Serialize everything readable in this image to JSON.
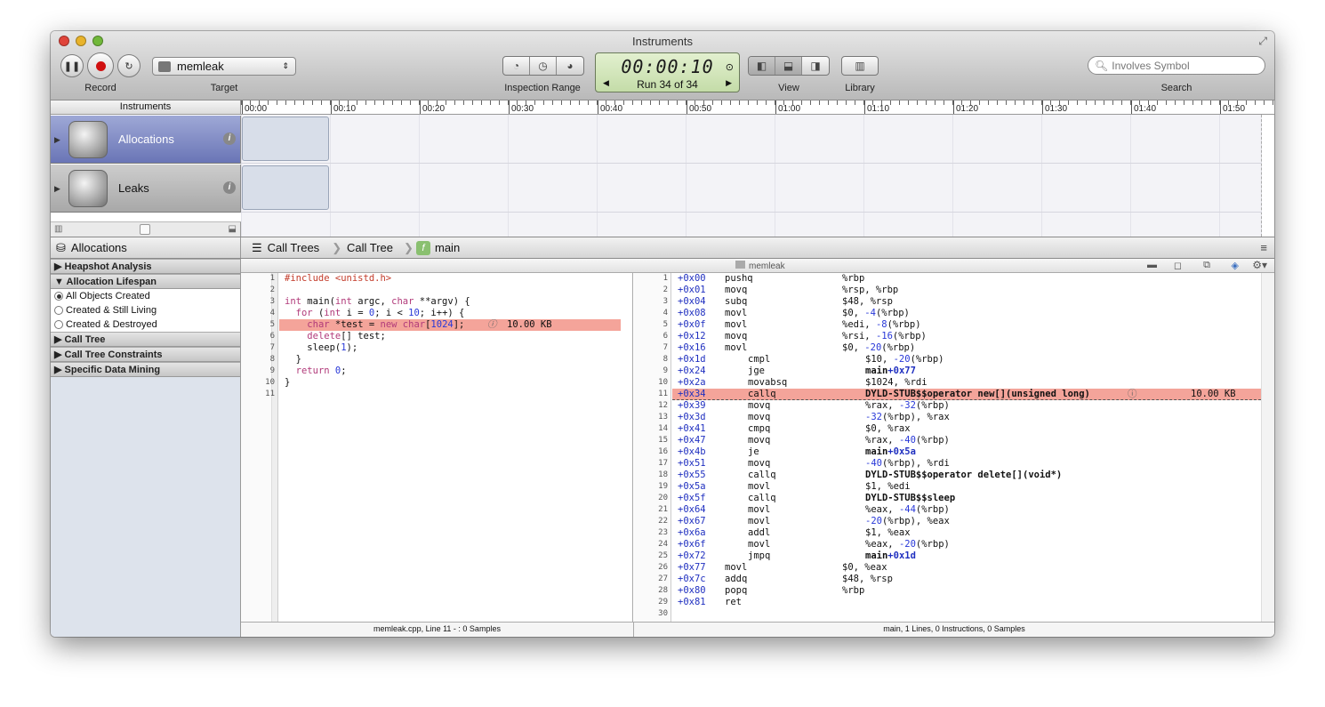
{
  "window": {
    "title": "Instruments"
  },
  "toolbar": {
    "record_label": "Record",
    "target_label": "Target",
    "target_value": "memleak",
    "inspection_label": "Inspection Range",
    "time": "00:00:10",
    "run": "Run 34 of 34",
    "view_label": "View",
    "library_label": "Library",
    "search_placeholder": "Involves Symbol",
    "search_label": "Search"
  },
  "instruments": {
    "header": "Instruments",
    "items": [
      {
        "name": "Allocations"
      },
      {
        "name": "Leaks"
      }
    ]
  },
  "ruler": [
    "00:00",
    "00:10",
    "00:20",
    "00:30",
    "00:40",
    "00:50",
    "01:00",
    "01:10",
    "01:20",
    "01:30",
    "01:40",
    "01:50"
  ],
  "nav": {
    "left": "Allocations",
    "crumbs": [
      "Call Trees",
      "Call Tree",
      "main"
    ]
  },
  "sidebar": {
    "heapshot": "Heapshot Analysis",
    "lifespan": "Allocation Lifespan",
    "options": [
      "All Objects Created",
      "Created & Still Living",
      "Created & Destroyed"
    ],
    "calltree": "Call Tree",
    "constraints": "Call Tree Constraints",
    "datamining": "Specific Data Mining"
  },
  "file_tab": "memleak",
  "source": {
    "lines": [
      "#include <unistd.h>",
      "",
      "int main(int argc, char **argv) {",
      "  for (int i = 0; i < 10; i++) {",
      "    char *test = new char[1024];",
      "    delete[] test;",
      "    sleep(1);",
      "  }",
      "  return 0;",
      "}",
      ""
    ],
    "hl_size": "10.00 KB",
    "footer": "memleak.cpp, Line 11 - : 0 Samples"
  },
  "asm": {
    "rows": [
      [
        "+0x00",
        "pushq",
        "%rbp"
      ],
      [
        "+0x01",
        "movq",
        "%rsp, %rbp"
      ],
      [
        "+0x04",
        "subq",
        "$48, %rsp"
      ],
      [
        "+0x08",
        "movl",
        "$0, -4(%rbp)"
      ],
      [
        "+0x0f",
        "movl",
        "%edi, -8(%rbp)"
      ],
      [
        "+0x12",
        "movq",
        "%rsi, -16(%rbp)"
      ],
      [
        "+0x16",
        "movl",
        "$0, -20(%rbp)"
      ],
      [
        "+0x1d",
        "cmpl",
        "$10, -20(%rbp)"
      ],
      [
        "+0x24",
        "jge",
        "main+0x77"
      ],
      [
        "+0x2a",
        "movabsq",
        "$1024, %rdi"
      ],
      [
        "+0x34",
        "callq",
        "DYLD-STUB$$operator new[](unsigned long)"
      ],
      [
        "+0x39",
        "movq",
        "%rax, -32(%rbp)"
      ],
      [
        "+0x3d",
        "movq",
        "-32(%rbp), %rax"
      ],
      [
        "+0x41",
        "cmpq",
        "$0, %rax"
      ],
      [
        "+0x47",
        "movq",
        "%rax, -40(%rbp)"
      ],
      [
        "+0x4b",
        "je",
        "main+0x5a"
      ],
      [
        "+0x51",
        "movq",
        "-40(%rbp), %rdi"
      ],
      [
        "+0x55",
        "callq",
        "DYLD-STUB$$operator delete[](void*)"
      ],
      [
        "+0x5a",
        "movl",
        "$1, %edi"
      ],
      [
        "+0x5f",
        "callq",
        "DYLD-STUB$$sleep"
      ],
      [
        "+0x64",
        "movl",
        "%eax, -44(%rbp)"
      ],
      [
        "+0x67",
        "movl",
        "-20(%rbp), %eax"
      ],
      [
        "+0x6a",
        "addl",
        "$1, %eax"
      ],
      [
        "+0x6f",
        "movl",
        "%eax, -20(%rbp)"
      ],
      [
        "+0x72",
        "jmpq",
        "main+0x1d"
      ],
      [
        "+0x77",
        "movl",
        "$0, %eax"
      ],
      [
        "+0x7c",
        "addq",
        "$48, %rsp"
      ],
      [
        "+0x80",
        "popq",
        "%rbp"
      ],
      [
        "+0x81",
        "ret",
        ""
      ]
    ],
    "line_count": 30,
    "hl_size": "10.00 KB",
    "footer": "main, 1 Lines, 0 Instructions, 0 Samples"
  },
  "colors": {
    "highlight": "#f4a49a",
    "selected_instrument": "#7a84c0",
    "lcd": "#d4e8bc"
  }
}
